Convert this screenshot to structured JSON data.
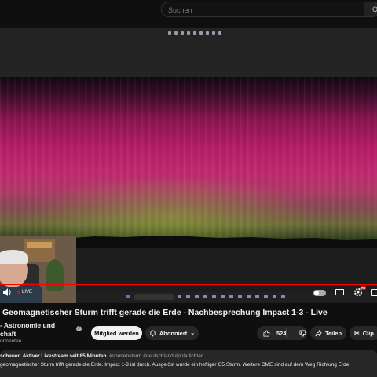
{
  "header": {
    "search_placeholder": "Suchen",
    "search_button": "Q"
  },
  "player": {
    "live_label": "LIVE",
    "progress": 1.0,
    "accent_color": "#ff0000"
  },
  "video": {
    "title": "Geomagnetischer Sturm trifft gerade die Erde - Nachbesprechung Impact 1-3 - Live",
    "channel_name_line1": "- Astronomie und",
    "channel_name_line2": "chaft",
    "subscriber_count": "onnenten"
  },
  "actions": {
    "join_label": "Mitglied werden",
    "subscribe_label": "Abonniert",
    "like_count": "524",
    "share_label": "Teilen",
    "clip_label": "Clip"
  },
  "description": {
    "viewers": "schauer",
    "stream_status": "Aktiver Livestream seit 85 Minuten",
    "tags": "#sonnensturm #deutschland #polarlichter",
    "text": "geomagnetischer Sturm trifft gerade die Erde. Impact 1-3 ist durch. Ausgelöst wurde ein heftiger G5 Sturm. Weitere CME sind auf dem Weg Richtung Erde."
  },
  "icons": {
    "volume": "volume-icon",
    "settings": "gear-icon",
    "subscribe_bell": "bell-icon",
    "like": "thumbs-up-icon",
    "dislike": "thumbs-down-icon",
    "share": "share-arrow-icon",
    "clip": "scissors-icon"
  }
}
